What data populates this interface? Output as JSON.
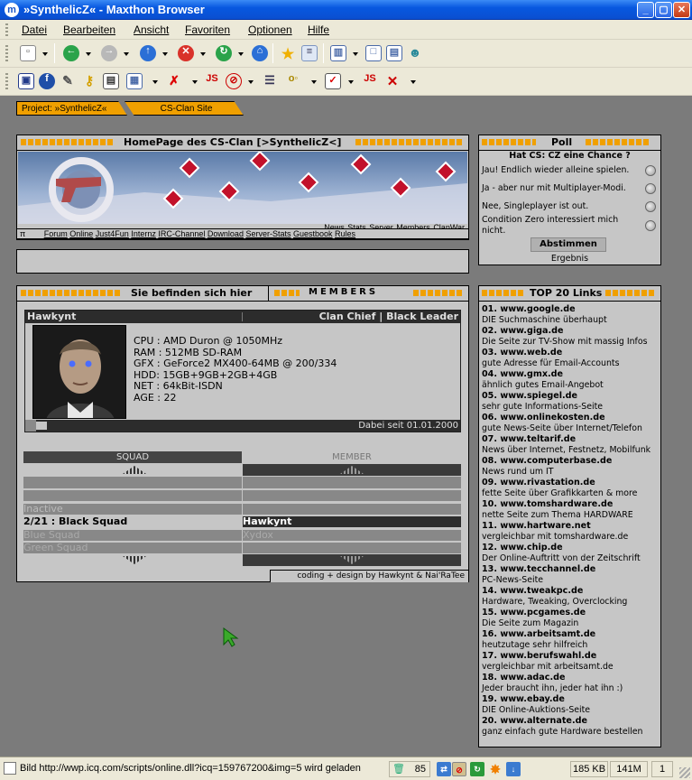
{
  "window": {
    "title": "»SynthelicZ« - Maxthon Browser",
    "app_icon": "maxthon-icon"
  },
  "menu": [
    "Datei",
    "Bearbeiten",
    "Ansicht",
    "Favoriten",
    "Optionen",
    "Hilfe"
  ],
  "tabs": [
    "Project: »SynthelicZ«",
    "CS-Clan Site"
  ],
  "banner": {
    "title": "HomePage des CS-Clan [>SynthelicZ<]",
    "nav_links": [
      "News",
      "Stats",
      "Server",
      "Members",
      "ClanWar"
    ],
    "sub_links": [
      "π",
      "Forum",
      "Online",
      "Just4Fun",
      "Internz",
      "IRC-Channel",
      "Download",
      "Server-Stats",
      "Guestbook",
      "Rules"
    ]
  },
  "poll": {
    "title": "Poll",
    "question": "Hat CS: CZ eine Chance ?",
    "options": [
      "Jau! Endlich wieder alleine spielen.",
      "Ja - aber nur mit Multiplayer-Modi.",
      "Nee, Singleplayer ist out.",
      "Condition Zero interessiert mich nicht."
    ],
    "vote_button": "Abstimmen",
    "results_link": "Ergebnis"
  },
  "members": {
    "location_label": "Sie befinden sich hier",
    "section_label": "MEMBERS",
    "name": "Hawkynt",
    "rank": "Clan Chief | Black Leader",
    "specs": [
      "CPU : AMD Duron @ 1050MHz",
      "RAM : 512MB SD-RAM",
      "GFX : GeForce2 MX400-64MB @ 200/334",
      "HDD: 15GB+9GB+2GB+4GB",
      "NET : 64kBit-ISDN",
      "AGE : 22"
    ],
    "since": "Dabei seit 01.01.2000",
    "squad_header": "SQUAD",
    "member_header": "MEMBER",
    "squad_rows": [
      "Inactive",
      "2/21 : Black Squad",
      "Blue Squad",
      "Green Squad"
    ],
    "member_rows": [
      "Hawkynt",
      "Xydox"
    ],
    "credits": "coding + design by Hawkynt & Nai'RaTee"
  },
  "top20": {
    "title": "TOP 20 Links",
    "items": [
      {
        "title": "01. www.google.de",
        "desc": "DIE Suchmaschine überhaupt"
      },
      {
        "title": "02. www.giga.de",
        "desc": "Die Seite zur TV-Show mit massig Infos"
      },
      {
        "title": "03. www.web.de",
        "desc": "gute Adresse für Email-Accounts"
      },
      {
        "title": "04. www.gmx.de",
        "desc": "ähnlich gutes Email-Angebot"
      },
      {
        "title": "05. www.spiegel.de",
        "desc": "sehr gute Informations-Seite"
      },
      {
        "title": "06. www.onlinekosten.de",
        "desc": "gute News-Seite über Internet/Telefon"
      },
      {
        "title": "07. www.teltarif.de",
        "desc": "News über Internet, Festnetz, Mobilfunk"
      },
      {
        "title": "08. www.computerbase.de",
        "desc": "News rund um IT"
      },
      {
        "title": "09. www.rivastation.de",
        "desc": "fette Seite über Grafikkarten & more"
      },
      {
        "title": "10. www.tomshardware.de",
        "desc": "nette Seite zum Thema HARDWARE"
      },
      {
        "title": "11. www.hartware.net",
        "desc": "vergleichbar mit tomshardware.de"
      },
      {
        "title": "12. www.chip.de",
        "desc": "Der Online-Auftritt von der Zeitschrift"
      },
      {
        "title": "13. www.tecchannel.de",
        "desc": "PC-News-Seite"
      },
      {
        "title": "14. www.tweakpc.de",
        "desc": "Hardware, Tweaking, Overclocking"
      },
      {
        "title": "15. www.pcgames.de",
        "desc": "Die Seite zum Magazin"
      },
      {
        "title": "16. www.arbeitsamt.de",
        "desc": "heutzutage sehr hilfreich"
      },
      {
        "title": "17. www.berufswahl.de",
        "desc": "vergleichbar mit arbeitsamt.de"
      },
      {
        "title": "18. www.adac.de",
        "desc": "Jeder braucht ihn, jeder hat ihn :)"
      },
      {
        "title": "19. www.ebay.de",
        "desc": "DIE Online-Auktions-Seite"
      },
      {
        "title": "20. www.alternate.de",
        "desc": "ganz einfach gute Hardware bestellen"
      }
    ]
  },
  "status": {
    "text": "Bild http://wwp.icq.com/scripts/online.dll?icq=159767200&img=5 wird geladen",
    "count": "85",
    "size": "185 KB",
    "memory": "141M",
    "page": "1"
  }
}
